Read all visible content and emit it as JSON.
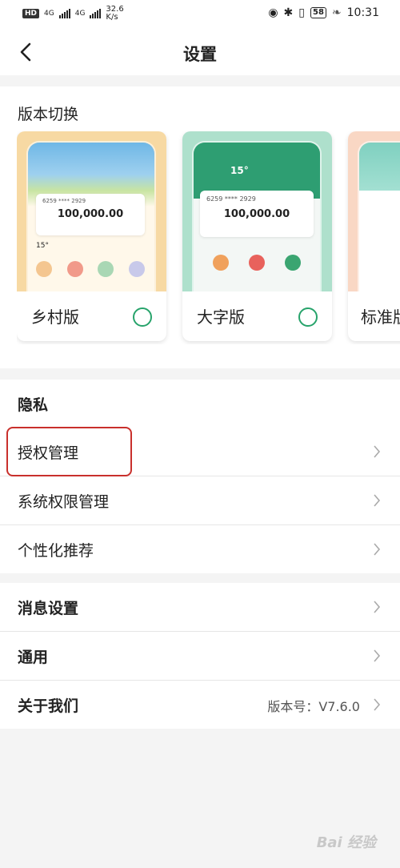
{
  "status_bar": {
    "hd": "HD",
    "net1": "4G",
    "net2": "4G",
    "speed": "32.6",
    "speed_unit": "K/s",
    "battery": "58",
    "time": "10:31"
  },
  "header": {
    "title": "设置"
  },
  "version_section": {
    "title": "版本切换",
    "cards": [
      {
        "label": "乡村版",
        "balance": "100,000.00",
        "account": "6259 **** 2929",
        "temp": "15°"
      },
      {
        "label": "大字版",
        "balance": "100,000.00",
        "account": "6259 **** 2929",
        "temp": "15°"
      },
      {
        "label": "标准版"
      }
    ]
  },
  "privacy": {
    "title": "隐私",
    "items": [
      {
        "label": "授权管理"
      },
      {
        "label": "系统权限管理"
      },
      {
        "label": "个性化推荐"
      }
    ]
  },
  "more": {
    "items": [
      {
        "label": "消息设置"
      },
      {
        "label": "通用"
      },
      {
        "label": "关于我们",
        "value": "版本号：V7.6.0"
      }
    ]
  },
  "watermark": "Bai 经验",
  "colors": {
    "accent_green": "#27a36b",
    "highlight_red": "#c9302c"
  }
}
